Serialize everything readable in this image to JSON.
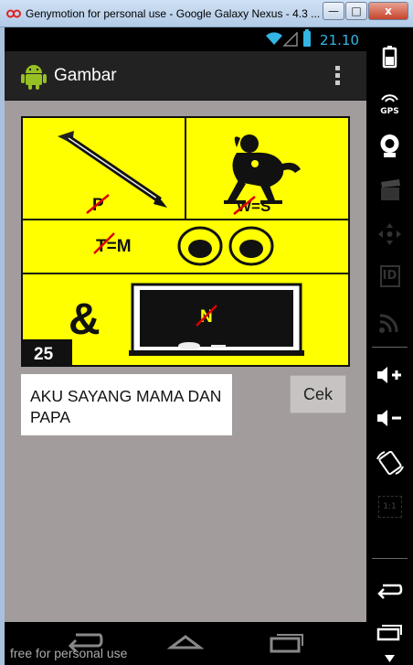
{
  "window": {
    "title": "Genymotion for personal use - Google Galaxy Nexus - 4.3 ...",
    "min_label": "—",
    "max_label": "□",
    "close_label": "x"
  },
  "statusbar": {
    "time": "21.10"
  },
  "actionbar": {
    "title": "Gambar"
  },
  "puzzle": {
    "level": "25",
    "hint_p": "P",
    "hint_ws": "W=S",
    "hint_tm": "T=M",
    "ampersand": "&",
    "hint_n": "N",
    "background_color": "#ffff00"
  },
  "answer": {
    "text": "AKU SAYANG MAMA DAN PAPA"
  },
  "check_button": {
    "label": "Cek"
  },
  "watermark": "free for personal use",
  "sidebar": {
    "items": [
      "battery-icon",
      "gps-icon",
      "camera-icon",
      "clapboard-icon",
      "dpad-icon",
      "id-icon",
      "rss-icon",
      "volume-up-icon",
      "volume-down-icon",
      "rotate-icon",
      "scale-icon",
      "back-icon",
      "recent-apps-icon",
      "menu-icon"
    ],
    "gps_label": "GPS",
    "id_label": "ID",
    "scale_label": "1:1"
  },
  "colors": {
    "accent": "#33b5e5",
    "app_background": "#a29c9c"
  }
}
